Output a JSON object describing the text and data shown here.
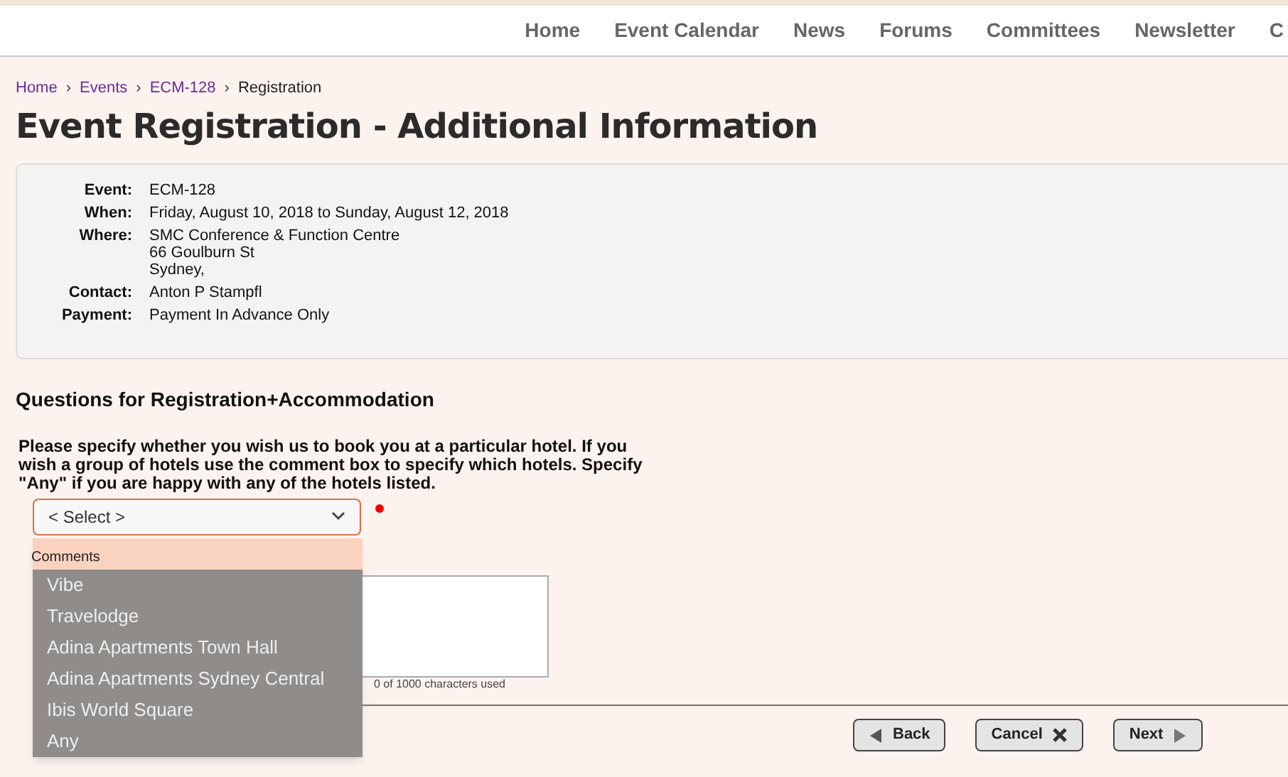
{
  "nav": [
    {
      "label": "Home"
    },
    {
      "label": "Event Calendar"
    },
    {
      "label": "News"
    },
    {
      "label": "Forums"
    },
    {
      "label": "Committees"
    },
    {
      "label": "Newsletter"
    },
    {
      "label": "C"
    }
  ],
  "breadcrumb_separator": "›",
  "breadcrumb": [
    {
      "label": "Home",
      "kind": "link"
    },
    {
      "label": "Events",
      "kind": "link"
    },
    {
      "label": "ECM-128",
      "kind": "link"
    },
    {
      "label": "Registration",
      "kind": "current"
    }
  ],
  "title": "Event Registration - Additional Information",
  "details": [
    {
      "label": "Event:",
      "value": [
        "ECM-128"
      ]
    },
    {
      "label": "When:",
      "value": [
        "Friday, August 10, 2018 to Sunday, August 12, 2018"
      ]
    },
    {
      "label": "Where:",
      "value": [
        "SMC Conference & Function Centre",
        "66 Goulburn St",
        "Sydney,"
      ]
    },
    {
      "label": "Contact:",
      "value": [
        "Anton P Stampfl"
      ]
    },
    {
      "label": "Payment:",
      "value": [
        "Payment In Advance Only"
      ]
    }
  ],
  "section_title": "Questions for Registration+Accommodation",
  "question": "Please specify whether you wish us to book you at a particular hotel. If you wish a group of hotels use the comment box to specify which hotels. Specify \"Any\" if you are happy with any of the hotels listed.",
  "hotel_select": {
    "value": "< Select >",
    "required": true,
    "expanded": true,
    "options": [
      {
        "selected": true
      },
      {
        "label": "Vibe",
        "selected": false
      },
      {
        "label": "Travelodge",
        "selected": false
      },
      {
        "label": "Adina Apartments Town Hall",
        "selected": false
      },
      {
        "label": "Adina Apartments Sydney Central",
        "selected": false
      },
      {
        "label": "Ibis World Square",
        "selected": false
      },
      {
        "label": "Any",
        "selected": false
      }
    ]
  },
  "comments": {
    "label": "Comments",
    "counter": "0 of 1000 characters used"
  },
  "buttons": [
    {
      "label": "Back",
      "kind": "back"
    },
    {
      "label": "Cancel",
      "kind": "cancel"
    },
    {
      "label": "Next",
      "kind": "next"
    }
  ]
}
